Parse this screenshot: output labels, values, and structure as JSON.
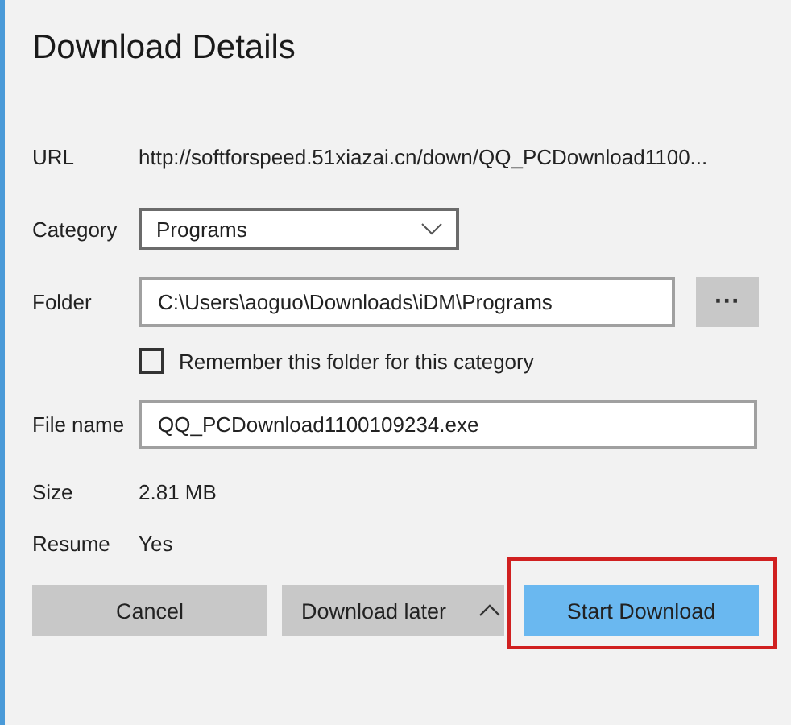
{
  "window": {
    "title": "Download Details"
  },
  "url": {
    "label": "URL",
    "value": "http://softforspeed.51xiazai.cn/down/QQ_PCDownload1100..."
  },
  "category": {
    "label": "Category",
    "value": "Programs"
  },
  "folder": {
    "label": "Folder",
    "value": "C:\\Users\\aoguo\\Downloads\\iDM\\Programs",
    "browse": "···"
  },
  "remember": {
    "label": "Remember this folder for this category",
    "checked": false
  },
  "file_name": {
    "label": "File name",
    "value": "QQ_PCDownload1100109234.exe"
  },
  "size": {
    "label": "Size",
    "value": "2.81 MB"
  },
  "resume": {
    "label": "Resume",
    "value": "Yes"
  },
  "buttons": [
    {
      "label": "Cancel",
      "kind": "plain"
    },
    {
      "label": "Download later",
      "kind": "split"
    },
    {
      "label": "Start Download",
      "kind": "primary",
      "highlighted": true
    }
  ]
}
